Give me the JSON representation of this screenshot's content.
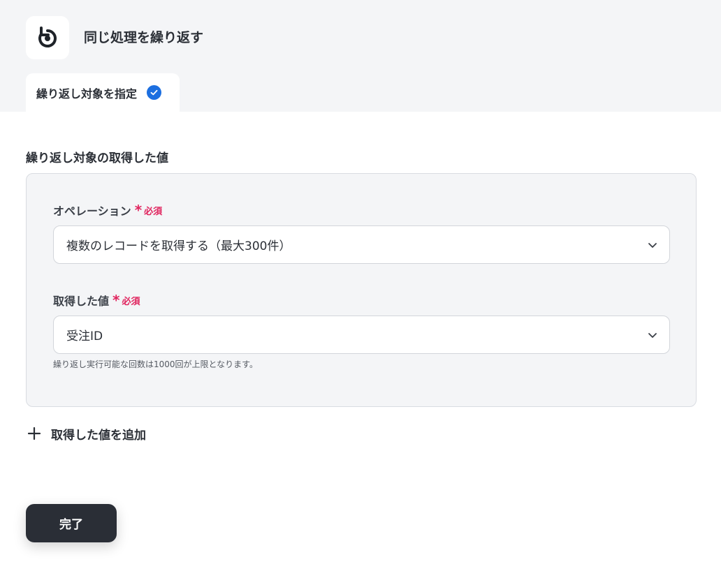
{
  "header": {
    "icon": "rotate-icon",
    "title": "同じ処理を繰り返す",
    "tab": {
      "label": "繰り返し対象を指定",
      "status_icon": "check-circle-icon"
    }
  },
  "section": {
    "title": "繰り返し対象の取得した値"
  },
  "fields": {
    "operation": {
      "label": "オペレーション",
      "required_mark": "*",
      "required_text": "必須",
      "value": "複数のレコードを取得する（最大300件）"
    },
    "value": {
      "label": "取得した値",
      "required_mark": "*",
      "required_text": "必須",
      "value": "受注ID",
      "hint": "繰り返し実行可能な回数は1000回が上限となります。"
    }
  },
  "actions": {
    "add_label": "取得した値を追加",
    "done_label": "完了"
  },
  "colors": {
    "accent": "#1c6fe0",
    "required": "#e0245e",
    "button_bg": "#2a2e36",
    "header_bg": "#f4f5f7"
  }
}
